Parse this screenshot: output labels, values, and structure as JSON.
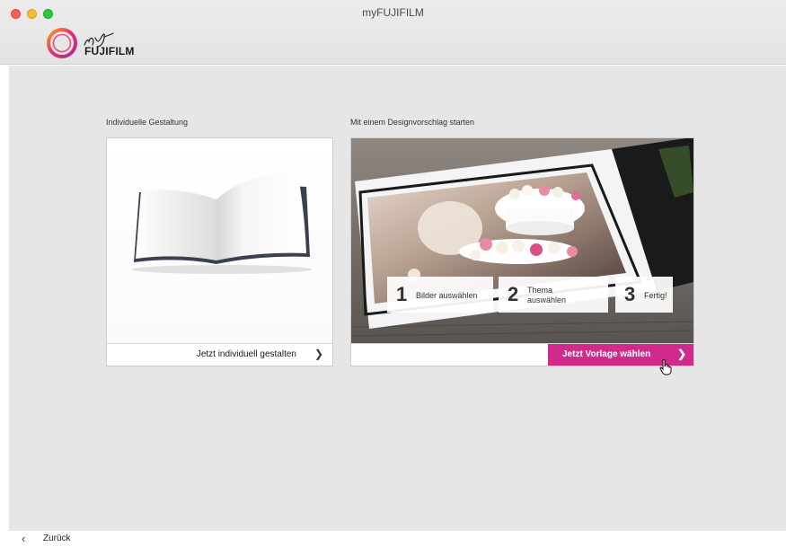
{
  "window": {
    "title": "myFUJIFILM"
  },
  "logo": {
    "script": "my",
    "brand": "FUJIFILM"
  },
  "left_card": {
    "label": "Individuelle Gestaltung",
    "button_label": "Jetzt individuell gestalten",
    "image": "open-blank-photobook"
  },
  "right_card": {
    "label": "Mit einem Designvorschlag starten",
    "button_label": "Jetzt Vorlage wählen",
    "image": "wedding-photobook-cake",
    "steps": [
      {
        "number": "1",
        "text": "Bilder auswählen"
      },
      {
        "number": "2",
        "text": "Thema auswählen",
        "line1": "Thema",
        "line2": "auswählen"
      },
      {
        "number": "3",
        "text": "Fertig!"
      }
    ]
  },
  "footer": {
    "back_label": "Zurück"
  },
  "colors": {
    "accent": "#cf2a8c",
    "background": "#e6e6e6"
  }
}
